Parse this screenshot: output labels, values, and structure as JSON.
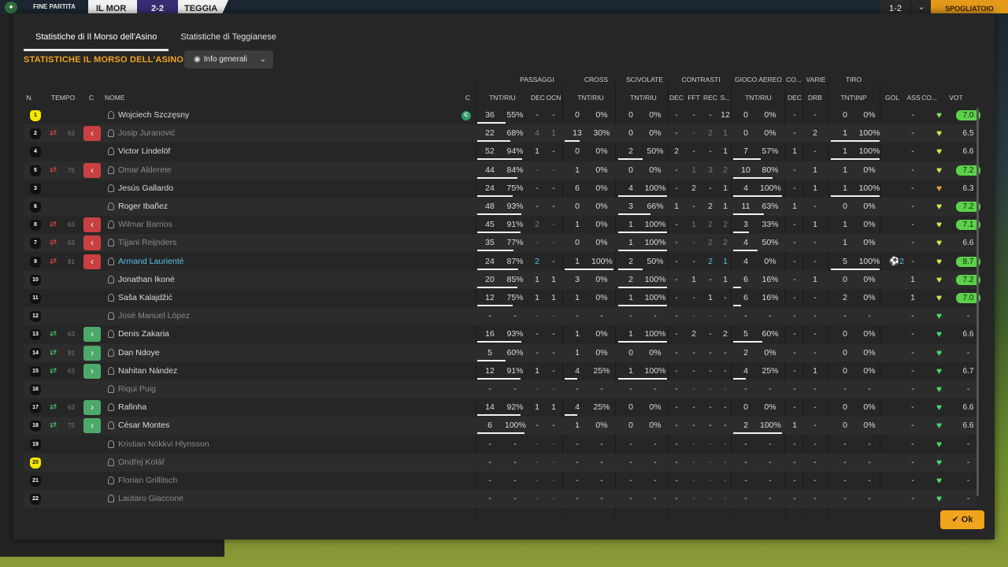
{
  "topbar": {
    "match_label": "FINE PARTITA",
    "team_home": "IL MOR",
    "score": "2-2",
    "team_away": "TEGGIA",
    "right_box": "1-2",
    "right_button": "SPOGLIATOIO"
  },
  "tabs": [
    {
      "label": "Statistiche di Il Morso dell'Asino",
      "active": true
    },
    {
      "label": "Statistiche di Teggianese",
      "active": false
    }
  ],
  "section_title": "STATISTICHE IL MORSO DELL'ASINO",
  "dropdown_label": "Info generali",
  "groups": [
    "PASSAGGI",
    "CROSS",
    "SCIVOLATE",
    "CONTRASTI",
    "GIOCO AEREO",
    "CO...",
    "VARIE",
    "TIRO"
  ],
  "headers": [
    "N.",
    "TEMPO",
    "C",
    "NOME",
    "C",
    "TNT/RIU",
    "DEC",
    "OCN",
    "TNT/RIU",
    "TNT/RIU",
    "DEC",
    "FFT",
    "REC",
    "S...",
    "TNT/RIU",
    "DEC",
    "DRB",
    "TNT\\INP",
    "GOL",
    "ASS",
    "CO...",
    "VOT"
  ],
  "ok_label": "Ok",
  "colors": {
    "accent": "#f0a31c",
    "out": "#c94040",
    "in": "#4da86b",
    "vote_green": "#5cd14a"
  },
  "rows": [
    {
      "n": "1",
      "gk": true,
      "sub": "",
      "min": "",
      "name": "Wojciech Szczęsny",
      "style": "",
      "capt": true,
      "cells": [
        "36",
        "55%",
        "-",
        "-",
        "0",
        "0%",
        "0",
        "0%",
        "-",
        "-",
        "-",
        "12",
        "0",
        "0%",
        "-",
        "-",
        "0",
        "0%",
        "",
        "-"
      ],
      "bars": [
        0.6,
        0,
        0,
        0,
        0,
        0.0
      ],
      "heart": "#7fd857",
      "vote": "7.0",
      "vgreen": true
    },
    {
      "n": "2",
      "gk": false,
      "sub": "out",
      "min": "63",
      "name": "Josip Juranović",
      "style": "out",
      "capt": false,
      "cells": [
        "22",
        "68%",
        "4",
        "1",
        "13",
        "30%",
        "0",
        "0%",
        "-",
        "-",
        "2",
        "1",
        "0",
        "0%",
        "-",
        "2",
        "1",
        "100%",
        "",
        "-"
      ],
      "bars": [
        0.7,
        0.3,
        0,
        0,
        0,
        1
      ],
      "heart": "#d9e04a",
      "vote": "6.5",
      "vgreen": false
    },
    {
      "n": "4",
      "gk": false,
      "sub": "",
      "min": "",
      "name": "Victor Lindelöf",
      "style": "",
      "capt": false,
      "cells": [
        "52",
        "94%",
        "1",
        "-",
        "0",
        "0%",
        "2",
        "50%",
        "2",
        "-",
        "-",
        "1",
        "7",
        "57%",
        "1",
        "-",
        "1",
        "100%",
        "",
        "-"
      ],
      "bars": [
        0.95,
        0,
        0.5,
        0,
        0.57,
        1
      ],
      "heart": "#d9e04a",
      "vote": "6.6",
      "vgreen": false
    },
    {
      "n": "5",
      "gk": false,
      "sub": "out",
      "min": "75",
      "name": "Omar Alderete",
      "style": "out",
      "capt": false,
      "cells": [
        "44",
        "84%",
        "-",
        "-",
        "1",
        "0%",
        "0",
        "0%",
        "-",
        "1",
        "3",
        "2",
        "10",
        "80%",
        "-",
        "1",
        "1",
        "0%",
        "",
        "-"
      ],
      "bars": [
        0.85,
        0,
        0,
        0,
        0.8,
        0
      ],
      "heart": "#d9e04a",
      "vote": "7.2",
      "vgreen": true
    },
    {
      "n": "3",
      "gk": false,
      "sub": "",
      "min": "",
      "name": "Jesús Gallardo",
      "style": "",
      "capt": false,
      "cells": [
        "24",
        "75%",
        "-",
        "-",
        "6",
        "0%",
        "4",
        "100%",
        "-",
        "2",
        "-",
        "1",
        "4",
        "100%",
        "-",
        "1",
        "1",
        "100%",
        "",
        "-"
      ],
      "bars": [
        0.75,
        0,
        1,
        0,
        1,
        1
      ],
      "heart": "#e0a14a",
      "vote": "6.3",
      "vgreen": false
    },
    {
      "n": "6",
      "gk": false,
      "sub": "",
      "min": "",
      "name": "Roger Ibañez",
      "style": "",
      "capt": false,
      "cells": [
        "48",
        "93%",
        "-",
        "-",
        "0",
        "0%",
        "3",
        "66%",
        "1",
        "-",
        "2",
        "1",
        "11",
        "63%",
        "1",
        "-",
        "0",
        "0%",
        "",
        "-"
      ],
      "bars": [
        0.93,
        0,
        0.66,
        0,
        0.63,
        0
      ],
      "heart": "#d9e04a",
      "vote": "7.2",
      "vgreen": true
    },
    {
      "n": "8",
      "gk": false,
      "sub": "out",
      "min": "63",
      "name": "Wilmar Barrios",
      "style": "out",
      "capt": false,
      "cells": [
        "45",
        "91%",
        "2",
        "-",
        "1",
        "0%",
        "1",
        "100%",
        "-",
        "1",
        "2",
        "2",
        "3",
        "33%",
        "-",
        "1",
        "1",
        "0%",
        "",
        "-"
      ],
      "bars": [
        0.91,
        0,
        1,
        0,
        0.33,
        0
      ],
      "heart": "#d9e04a",
      "vote": "7.1",
      "vgreen": true
    },
    {
      "n": "7",
      "gk": false,
      "sub": "out",
      "min": "63",
      "name": "Tijjani Reijnders",
      "style": "out",
      "capt": false,
      "cells": [
        "35",
        "77%",
        "-",
        "-",
        "0",
        "0%",
        "1",
        "100%",
        "-",
        "-",
        "2",
        "2",
        "4",
        "50%",
        "-",
        "-",
        "1",
        "0%",
        "",
        "-"
      ],
      "bars": [
        0.77,
        0,
        1,
        0,
        0.5,
        0
      ],
      "heart": "#d9e04a",
      "vote": "6.6",
      "vgreen": false
    },
    {
      "n": "9",
      "gk": false,
      "sub": "out",
      "min": "81",
      "name": "Armand Laurienté",
      "style": "blue",
      "capt": false,
      "cells": [
        "24",
        "87%",
        "2",
        "-",
        "1",
        "100%",
        "2",
        "50%",
        "-",
        "-",
        "2",
        "1",
        "4",
        "0%",
        "-",
        "-",
        "5",
        "100%",
        "2",
        "-"
      ],
      "bars": [
        0.87,
        1,
        0.5,
        0,
        0,
        1
      ],
      "heart": "#d9e04a",
      "vote": "8.7",
      "vgreen": true
    },
    {
      "n": "10",
      "gk": false,
      "sub": "",
      "min": "",
      "name": "Jonathan Ikoné",
      "style": "",
      "capt": false,
      "cells": [
        "20",
        "85%",
        "1",
        "1",
        "3",
        "0%",
        "2",
        "100%",
        "-",
        "1",
        "-",
        "1",
        "6",
        "16%",
        "-",
        "1",
        "0",
        "0%",
        "",
        "1"
      ],
      "bars": [
        0.85,
        0,
        1,
        0,
        0.16,
        0
      ],
      "heart": "#d9e04a",
      "vote": "7.2",
      "vgreen": true
    },
    {
      "n": "11",
      "gk": false,
      "sub": "",
      "min": "",
      "name": "Saša Kalajdžić",
      "style": "",
      "capt": false,
      "cells": [
        "12",
        "75%",
        "1",
        "1",
        "1",
        "0%",
        "1",
        "100%",
        "-",
        "-",
        "1",
        "-",
        "6",
        "16%",
        "-",
        "-",
        "2",
        "0%",
        "",
        "1"
      ],
      "bars": [
        0.75,
        0,
        1,
        0,
        0.16,
        0
      ],
      "heart": "#d9e04a",
      "vote": "7.0",
      "vgreen": true
    },
    {
      "n": "12",
      "gk": false,
      "sub": "",
      "min": "",
      "name": "José Manuel López",
      "style": "out",
      "capt": false,
      "cells": [
        "-",
        "-",
        "-",
        "-",
        "-",
        "-",
        "-",
        "-",
        "-",
        "-",
        "-",
        "-",
        "-",
        "-",
        "-",
        "-",
        "-",
        "-",
        "",
        "-"
      ],
      "bars": [
        0,
        0,
        0,
        0,
        0,
        0
      ],
      "heart": "#4cd664",
      "vote": "-",
      "vgreen": false
    },
    {
      "n": "13",
      "gk": false,
      "sub": "in",
      "min": "63",
      "name": "Denis Zakaria",
      "style": "",
      "capt": false,
      "cells": [
        "16",
        "93%",
        "-",
        "-",
        "1",
        "0%",
        "1",
        "100%",
        "-",
        "2",
        "-",
        "2",
        "5",
        "60%",
        "-",
        "-",
        "0",
        "0%",
        "",
        "-"
      ],
      "bars": [
        0.93,
        0,
        1,
        0,
        0.6,
        0
      ],
      "heart": "#4cd664",
      "vote": "6.6",
      "vgreen": false
    },
    {
      "n": "14",
      "gk": false,
      "sub": "in",
      "min": "81",
      "name": "Dan Ndoye",
      "style": "",
      "capt": false,
      "cells": [
        "5",
        "60%",
        "-",
        "-",
        "1",
        "0%",
        "0",
        "0%",
        "-",
        "-",
        "-",
        "-",
        "2",
        "0%",
        "-",
        "-",
        "0",
        "0%",
        "",
        "-"
      ],
      "bars": [
        0.6,
        0,
        0,
        0,
        0,
        0
      ],
      "heart": "#4cd664",
      "vote": "-",
      "vgreen": false
    },
    {
      "n": "15",
      "gk": false,
      "sub": "in",
      "min": "63",
      "name": "Nahitan Nández",
      "style": "",
      "capt": false,
      "cells": [
        "12",
        "91%",
        "1",
        "-",
        "4",
        "25%",
        "1",
        "100%",
        "-",
        "-",
        "-",
        "-",
        "4",
        "25%",
        "-",
        "1",
        "0",
        "0%",
        "",
        "-"
      ],
      "bars": [
        0.91,
        0.25,
        1,
        0,
        0.25,
        0
      ],
      "heart": "#4cd664",
      "vote": "6.7",
      "vgreen": false
    },
    {
      "n": "16",
      "gk": false,
      "sub": "",
      "min": "",
      "name": "Riqui Puig",
      "style": "out",
      "capt": false,
      "cells": [
        "-",
        "-",
        "-",
        "-",
        "-",
        "-",
        "-",
        "-",
        "-",
        "-",
        "-",
        "-",
        "-",
        "-",
        "-",
        "-",
        "-",
        "-",
        "",
        "-"
      ],
      "bars": [
        0,
        0,
        0,
        0,
        0,
        0
      ],
      "heart": "#4cd664",
      "vote": "-",
      "vgreen": false
    },
    {
      "n": "17",
      "gk": false,
      "sub": "in",
      "min": "63",
      "name": "Rafinha",
      "style": "",
      "capt": false,
      "cells": [
        "14",
        "92%",
        "1",
        "1",
        "4",
        "25%",
        "0",
        "0%",
        "-",
        "-",
        "-",
        "-",
        "0",
        "0%",
        "-",
        "-",
        "0",
        "0%",
        "",
        "-"
      ],
      "bars": [
        0.92,
        0.25,
        0,
        0,
        0,
        0
      ],
      "heart": "#4cd664",
      "vote": "6.6",
      "vgreen": false
    },
    {
      "n": "18",
      "gk": false,
      "sub": "in",
      "min": "75",
      "name": "César Montes",
      "style": "",
      "capt": false,
      "cells": [
        "6",
        "100%",
        "-",
        "-",
        "1",
        "0%",
        "0",
        "0%",
        "-",
        "-",
        "-",
        "-",
        "2",
        "100%",
        "1",
        "-",
        "0",
        "0%",
        "",
        "-"
      ],
      "bars": [
        1,
        0,
        0,
        0,
        1,
        0
      ],
      "heart": "#4cd664",
      "vote": "6.6",
      "vgreen": false
    },
    {
      "n": "19",
      "gk": false,
      "sub": "",
      "min": "",
      "name": "Kristian Nökkvi Hlynsson",
      "style": "out",
      "capt": false,
      "cells": [
        "-",
        "-",
        "-",
        "-",
        "-",
        "-",
        "-",
        "-",
        "-",
        "-",
        "-",
        "-",
        "-",
        "-",
        "-",
        "-",
        "-",
        "-",
        "",
        "-"
      ],
      "bars": [
        0,
        0,
        0,
        0,
        0,
        0
      ],
      "heart": "#4cd664",
      "vote": "-",
      "vgreen": false
    },
    {
      "n": "20",
      "gk": true,
      "sub": "",
      "min": "",
      "name": "Ondřej Kolář",
      "style": "out",
      "capt": false,
      "cells": [
        "-",
        "-",
        "-",
        "-",
        "-",
        "-",
        "-",
        "-",
        "-",
        "-",
        "-",
        "-",
        "-",
        "-",
        "-",
        "-",
        "-",
        "-",
        "",
        "-"
      ],
      "bars": [
        0,
        0,
        0,
        0,
        0,
        0
      ],
      "heart": "#4cd664",
      "vote": "-",
      "vgreen": false
    },
    {
      "n": "21",
      "gk": false,
      "sub": "",
      "min": "",
      "name": "Florian Grillitsch",
      "style": "out",
      "capt": false,
      "cells": [
        "-",
        "-",
        "-",
        "-",
        "-",
        "-",
        "-",
        "-",
        "-",
        "-",
        "-",
        "-",
        "-",
        "-",
        "-",
        "-",
        "-",
        "-",
        "",
        "-"
      ],
      "bars": [
        0,
        0,
        0,
        0,
        0,
        0
      ],
      "heart": "#4cd664",
      "vote": "-",
      "vgreen": false
    },
    {
      "n": "22",
      "gk": false,
      "sub": "",
      "min": "",
      "name": "Lautaro Giaccone",
      "style": "out",
      "capt": false,
      "cells": [
        "-",
        "-",
        "-",
        "-",
        "-",
        "-",
        "-",
        "-",
        "-",
        "-",
        "-",
        "-",
        "-",
        "-",
        "-",
        "-",
        "-",
        "-",
        "",
        "-"
      ],
      "bars": [
        0,
        0,
        0,
        0,
        0,
        0
      ],
      "heart": "#4cd664",
      "vote": "-",
      "vgreen": false
    }
  ]
}
